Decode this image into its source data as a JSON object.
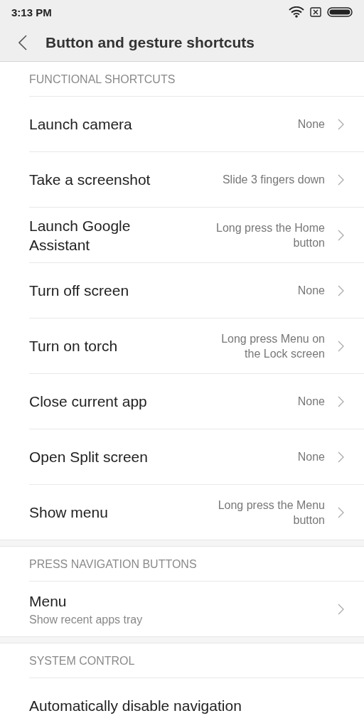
{
  "status_bar": {
    "time": "3:13 PM"
  },
  "header": {
    "title": "Button and gesture shortcuts"
  },
  "sections": [
    {
      "title": "FUNCTIONAL SHORTCUTS",
      "items": [
        {
          "label": "Launch camera",
          "value": "None"
        },
        {
          "label": "Take a screenshot",
          "value": "Slide 3 fingers down"
        },
        {
          "label": "Launch Google Assistant",
          "value": "Long press the Home button"
        },
        {
          "label": "Turn off screen",
          "value": "None"
        },
        {
          "label": "Turn on torch",
          "value": "Long press Menu on the Lock screen"
        },
        {
          "label": "Close current app",
          "value": "None"
        },
        {
          "label": "Open Split screen",
          "value": "None"
        },
        {
          "label": "Show menu",
          "value": "Long press the Menu button"
        }
      ]
    },
    {
      "title": "PRESS NAVIGATION BUTTONS",
      "items": [
        {
          "label": "Menu",
          "subtitle": "Show recent apps tray"
        }
      ]
    },
    {
      "title": "SYSTEM CONTROL",
      "items": [
        {
          "label": "Automatically disable navigation"
        }
      ]
    }
  ]
}
